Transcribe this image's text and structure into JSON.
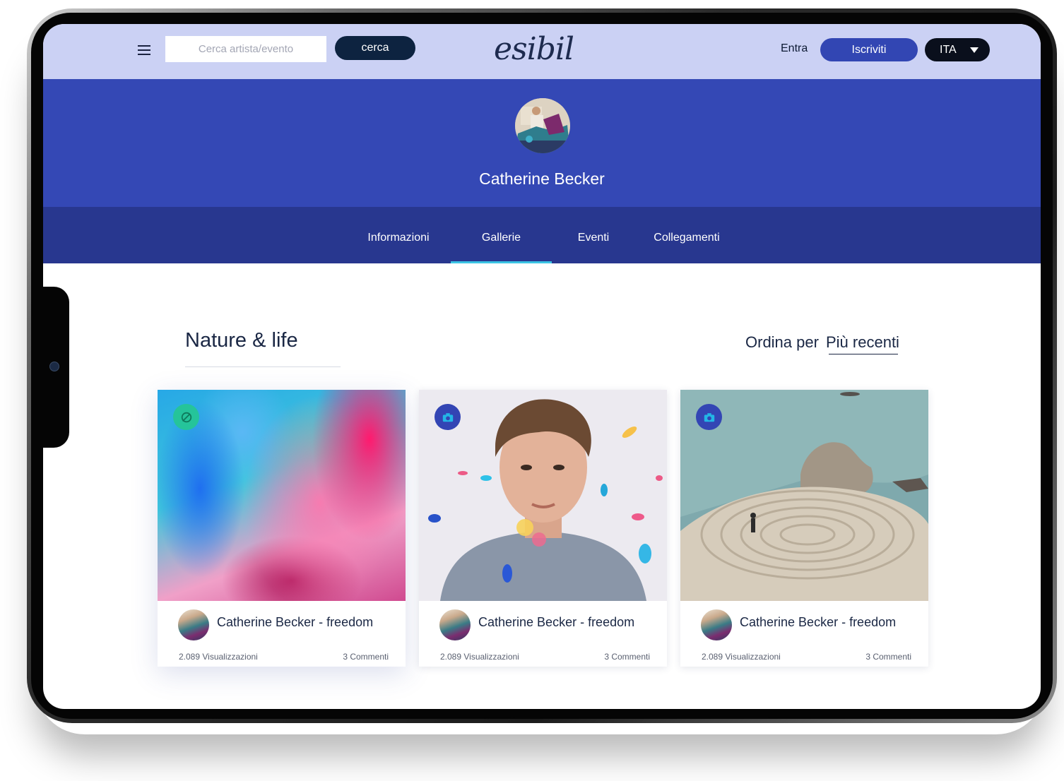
{
  "header": {
    "search_placeholder": "Cerca artista/evento",
    "search_button": "cerca",
    "logo": "esibil",
    "login": "Entra",
    "signup": "Iscriviti",
    "language": "ITA"
  },
  "profile": {
    "name": "Catherine Becker"
  },
  "tabs": [
    {
      "label": "Informazioni",
      "active": false
    },
    {
      "label": "Gallerie",
      "active": true
    },
    {
      "label": "Eventi",
      "active": false
    },
    {
      "label": "Collegamenti",
      "active": false
    }
  ],
  "gallery": {
    "title": "Nature & life",
    "sort_label": "Ordina per",
    "sort_value": "Più recenti"
  },
  "cards": [
    {
      "title": "Catherine Becker - freedom",
      "views": "2.089 Visualizzazioni",
      "comments": "3 Commenti",
      "badge_icon": "palette-icon",
      "image": "abstract-painting"
    },
    {
      "title": "Catherine Becker - freedom",
      "views": "2.089 Visualizzazioni",
      "comments": "3 Commenti",
      "badge_icon": "camera-icon",
      "image": "portrait-photo"
    },
    {
      "title": "Catherine Becker - freedom",
      "views": "2.089 Visualizzazioni",
      "comments": "3 Commenti",
      "badge_icon": "camera-icon",
      "image": "coastal-labyrinth-photo"
    }
  ],
  "colors": {
    "topbar": "#cbd1f4",
    "hero": "#3448b5",
    "tabs": "#28378f",
    "accent_underline": "#3cc4e4",
    "dark_button": "#0d2340",
    "signup_button": "#3246b3"
  }
}
